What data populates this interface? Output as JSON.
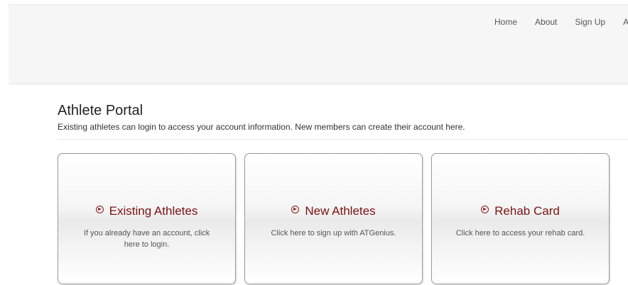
{
  "nav": {
    "items": [
      "Home",
      "About",
      "Sign Up",
      "A"
    ]
  },
  "portal": {
    "title": "Athlete Portal",
    "subtitle": "Existing athletes can login to access your account information. New members can create their account here."
  },
  "cards": [
    {
      "title": "Existing Athletes",
      "description": "If you already have an account, click here to login.",
      "icon": "circle-arrow-right-icon"
    },
    {
      "title": "New Athletes",
      "description": "Click here to sign up with ATGenius.",
      "icon": "circle-arrow-right-icon"
    },
    {
      "title": "Rehab Card",
      "description": "Click here to access your rehab card.",
      "icon": "circle-arrow-right-icon"
    }
  ],
  "colors": {
    "accent": "#7a1212",
    "header_bg": "#f6f6f6"
  }
}
